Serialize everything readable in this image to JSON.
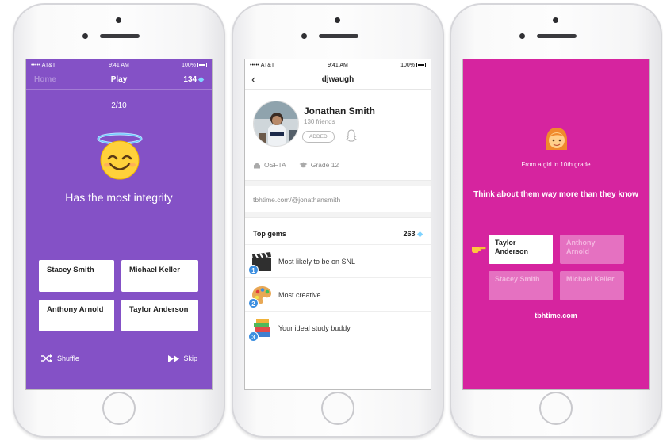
{
  "screen_play": {
    "status": {
      "carrier": "••••• AT&T",
      "time": "9:41 AM",
      "battery": "100%"
    },
    "nav": {
      "home": "Home",
      "title": "Play",
      "gems": "134"
    },
    "progress": "2/10",
    "question": "Has the most integrity",
    "choices": [
      "Stacey Smith",
      "Michael Keller",
      "Anthony Arnold",
      "Taylor Anderson"
    ],
    "shuffle": "Shuffle",
    "skip": "Skip",
    "bg_color": "#8451c6"
  },
  "screen_profile": {
    "status": {
      "carrier": "••••• AT&T",
      "time": "9:41 AM",
      "battery": "100%"
    },
    "nav": {
      "title": "djwaugh"
    },
    "name": "Jonathan Smith",
    "friends": "130 friends",
    "added": "ADDED",
    "school": "OSFTA",
    "grade": "Grade 12",
    "link": "tbhtime.com/@jonathansmith",
    "top_gems_label": "Top gems",
    "top_gems_count": "263",
    "gems": [
      {
        "rank": "1",
        "label": "Most likely to be on SNL",
        "icon": "clapper-icon"
      },
      {
        "rank": "2",
        "label": "Most creative",
        "icon": "palette-icon"
      },
      {
        "rank": "3",
        "label": "Your ideal study buddy",
        "icon": "books-icon"
      }
    ]
  },
  "screen_reveal": {
    "from": "From a girl in 10th grade",
    "think": "Think about them way more than they know",
    "choices": [
      "Taylor Anderson",
      "Anthony Arnold",
      "Stacey Smith",
      "Michael Keller"
    ],
    "selected": "Taylor Anderson",
    "site": "tbhtime.com",
    "bg_color": "#d6249f"
  }
}
